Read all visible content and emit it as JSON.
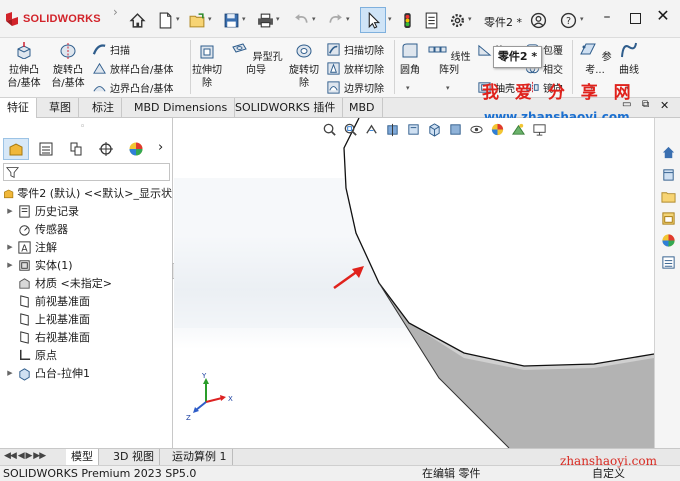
{
  "app": {
    "brand": "SOLIDWORKS",
    "brand_color": "#d2232a",
    "document": "零件2 *",
    "tooltip": "零件2 *"
  },
  "quick_access": [
    "home-icon",
    "new-file-icon",
    "open-file-icon",
    "save-icon",
    "print-icon",
    "undo-icon",
    "redo-icon",
    "select-icon",
    "rebuild-icon",
    "file-properties-icon",
    "options-icon",
    "user-icon",
    "help-icon"
  ],
  "commands": {
    "extrude_boss": "拉伸凸台/基体",
    "revolve_boss": "旋转凸台/基体",
    "sweep": "扫描",
    "loft": "放样凸台/基体",
    "boundary_boss": "边界凸台/基体",
    "extrude_cut": "拉伸切除",
    "hole_wizard": "异型孔向导",
    "revolve_cut": "旋转切除",
    "swept_cut": "扫描切除",
    "lofted_cut": "放样切除",
    "boundary_cut": "边界切除",
    "fillet": "圆角",
    "linear_pattern": "线性阵列",
    "rib": "筋",
    "shell": "抽壳",
    "wrap": "包覆",
    "intersect": "相交",
    "mirror": "镜向",
    "reference": "参考...",
    "curves": "曲线"
  },
  "tabs": [
    "特征",
    "草图",
    "标注",
    "MBD Dimensions",
    "SOLIDWORKS 插件",
    "MBD"
  ],
  "active_tab": 0,
  "tree": {
    "root": "零件2 (默认) <<默认>_显示状",
    "items": [
      {
        "label": "历史记录",
        "icon": "history-icon",
        "expandable": true
      },
      {
        "label": "传感器",
        "icon": "sensor-icon",
        "expandable": false
      },
      {
        "label": "注解",
        "icon": "annotation-icon",
        "expandable": true
      },
      {
        "label": "实体(1)",
        "icon": "solid-body-icon",
        "expandable": true
      },
      {
        "label": "材质 <未指定>",
        "icon": "material-icon",
        "expandable": false
      },
      {
        "label": "前视基准面",
        "icon": "plane-icon",
        "expandable": false
      },
      {
        "label": "上视基准面",
        "icon": "plane-icon",
        "expandable": false
      },
      {
        "label": "右视基准面",
        "icon": "plane-icon",
        "expandable": false
      },
      {
        "label": "原点",
        "icon": "origin-icon",
        "expandable": false
      },
      {
        "label": "凸台-拉伸1",
        "icon": "extrude-feature-icon",
        "expandable": true
      }
    ]
  },
  "bottom_tabs": [
    "模型",
    "3D 视图",
    "运动算例 1"
  ],
  "status": {
    "left": "SOLIDWORKS Premium 2023 SP5.0",
    "middle": "在编辑 零件",
    "right": "自定义"
  },
  "watermark": {
    "title": "我 爱 分 享 网",
    "url": "www.zhanshaoyi.com",
    "url_bottom": "zhanshaoyi.com"
  },
  "triad": {
    "x": "X",
    "y": "Y",
    "z": "Z"
  }
}
